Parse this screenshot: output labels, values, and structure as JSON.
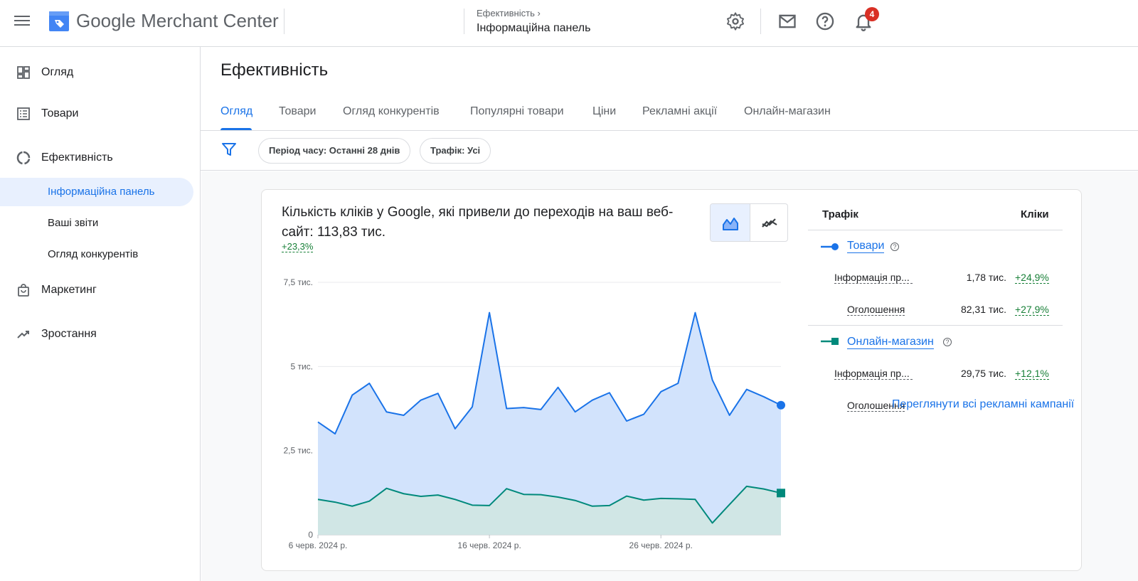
{
  "header": {
    "brand_prefix": "Google",
    "brand_suffix": "Merchant Center",
    "breadcrumb_parent": "Ефективність",
    "breadcrumb_current": "Інформаційна панель",
    "notifications_count": "4"
  },
  "sidebar": {
    "items": [
      {
        "label": "Огляд",
        "icon": "dashboard-icon"
      },
      {
        "label": "Товари",
        "icon": "list-icon"
      },
      {
        "label": "Ефективність",
        "icon": "performance-icon"
      },
      {
        "label": "Маркетинг",
        "icon": "shopping-bag-icon"
      },
      {
        "label": "Зростання",
        "icon": "trending-up-icon"
      }
    ],
    "sub_items": [
      {
        "label": "Інформаційна панель",
        "active": true
      },
      {
        "label": "Ваші звіти"
      },
      {
        "label": "Огляд конкурентів"
      }
    ]
  },
  "main": {
    "title": "Ефективність",
    "tabs": [
      "Огляд",
      "Товари",
      "Огляд конкурентів",
      "Популярні товари",
      "Ціни",
      "Рекламні акції",
      "Онлайн-магазин"
    ],
    "filters": [
      "Період часу: Останні 28 днів",
      "Трафік: Усі"
    ]
  },
  "card": {
    "title": "Кількість кліків у Google, які привели до переходів на ваш веб-сайт: 113,83 тис.",
    "delta": "+23,3%",
    "table": {
      "col_traffic": "Трафік",
      "col_clicks": "Кліки",
      "groups": [
        {
          "name": "Товари",
          "color": "#1a73e8",
          "rows": [
            {
              "label": "Інформація пр...",
              "value": "1,78 тис.",
              "delta": "+24,9%"
            },
            {
              "label": "Оголошення",
              "value": "82,31 тис.",
              "delta": "+27,9%"
            }
          ]
        },
        {
          "name": "Онлайн-магазин",
          "color": "#00897b",
          "rows": [
            {
              "label": "Інформація пр...",
              "value": "29,75 тис.",
              "delta": "+12,1%"
            },
            {
              "label": "Оголошення",
              "value": "",
              "delta": ""
            }
          ]
        }
      ]
    },
    "all_campaigns_link": "Переглянути всі рекламні кампанії"
  },
  "chart_data": {
    "type": "area",
    "x_tick_labels": [
      "6 черв. 2024 р.",
      "16 черв. 2024 р.",
      "26 черв. 2024 р."
    ],
    "y_tick_labels": [
      "7,5 тис.",
      "5 тис.",
      "2,5 тис.",
      "0"
    ],
    "ylim": [
      0,
      7500
    ],
    "series": [
      {
        "name": "Товари",
        "color": "#1a73e8",
        "values": [
          3350,
          3000,
          4150,
          4500,
          3650,
          3550,
          4000,
          4200,
          3150,
          3800,
          6600,
          3750,
          3780,
          3720,
          4380,
          3650,
          4000,
          4220,
          3380,
          3580,
          4250,
          4500,
          6600,
          4600,
          3550,
          4320,
          4100,
          3850
        ]
      },
      {
        "name": "Онлайн-магазин",
        "color": "#00897b",
        "values": [
          1050,
          970,
          850,
          1000,
          1380,
          1220,
          1140,
          1180,
          1050,
          880,
          870,
          1370,
          1200,
          1190,
          1120,
          1020,
          850,
          870,
          1150,
          1030,
          1080,
          1070,
          1050,
          350,
          900,
          1440,
          1360,
          1240
        ]
      }
    ],
    "grid": true,
    "legend": "right-table"
  }
}
